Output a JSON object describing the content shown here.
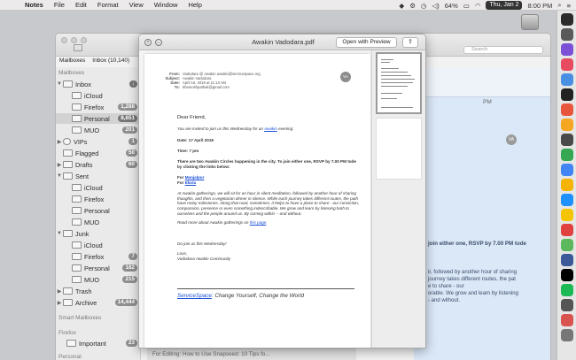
{
  "menubar": {
    "apple": "",
    "app_name": "Notes",
    "items": [
      "File",
      "Edit",
      "Format",
      "View",
      "Window",
      "Help"
    ],
    "battery": "64%",
    "date": "Thu, Jan 2",
    "time": "8:00 PM"
  },
  "mail": {
    "tabs": [
      "Mailboxes",
      "Inbox (10,140)"
    ],
    "search_placeholder": "Search",
    "sidebar": {
      "headers": [
        "Mailboxes",
        "Smart Mailboxes",
        "Firefox",
        "Personal"
      ],
      "rows": [
        {
          "label": "Inbox",
          "count": "",
          "indent": 0
        },
        {
          "label": "iCloud",
          "count": "",
          "indent": 1
        },
        {
          "label": "Firefox",
          "count": "1,288",
          "indent": 1
        },
        {
          "label": "Personal",
          "count": "8,651",
          "indent": 1
        },
        {
          "label": "MUO",
          "count": "201",
          "indent": 1
        },
        {
          "label": "VIPs",
          "count": "1",
          "indent": 0
        },
        {
          "label": "Flagged",
          "count": "50",
          "indent": 0
        },
        {
          "label": "Drafts",
          "count": "60",
          "indent": 0
        },
        {
          "label": "Sent",
          "count": "",
          "indent": 0
        },
        {
          "label": "iCloud",
          "count": "",
          "indent": 1
        },
        {
          "label": "Firefox",
          "count": "",
          "indent": 1
        },
        {
          "label": "Personal",
          "count": "",
          "indent": 1
        },
        {
          "label": "MUO",
          "count": "",
          "indent": 1
        },
        {
          "label": "Junk",
          "count": "",
          "indent": 0
        },
        {
          "label": "iCloud",
          "count": "",
          "indent": 1
        },
        {
          "label": "Firefox",
          "count": "7",
          "indent": 1
        },
        {
          "label": "Personal",
          "count": "182",
          "indent": 1
        },
        {
          "label": "MUO",
          "count": "215",
          "indent": 1
        },
        {
          "label": "Trash",
          "count": "",
          "indent": 0
        },
        {
          "label": "Archive",
          "count": "14,444",
          "indent": 0
        },
        {
          "label": "Important",
          "count": "23",
          "indent": 1
        }
      ]
    },
    "right_pane": {
      "time_fragment": "PM",
      "avatar": "VA",
      "snippets": [
        "join either one, RSVP by 7.00 PM tode",
        "ir, followed by another hour of sharing",
        "journey takes different routes, the pat",
        "e to share - our",
        "orable. We grow and learn by listening",
        "- and without."
      ]
    },
    "bottom_strip": "For Editing: How to Use Snapseed: 10 Tips fo..."
  },
  "preview": {
    "title": "Awakin Vadodara.pdf",
    "open_button": "Open with Preview",
    "share_icon": "share-icon",
    "header": {
      "from_label": "From:",
      "from_value": "Vadodara @ Awakin awakin@servicespace.org",
      "subject_label": "Subject:",
      "subject_value": "Awakin Vadodara",
      "date_label": "Date:",
      "date_value": "April 16, 2019 at 11:13 AM",
      "to_label": "To:",
      "to_value": "khamoshpathak@gmail.com",
      "avatar": "VA"
    },
    "greeting": "Dear Friend,",
    "intro_pre": "You are invited to join us this Wednesday for an ",
    "intro_link": "Awakin",
    "intro_post": " evening:",
    "date_line": "Date: 17 April 2019",
    "time_line": "Time: 7 pm",
    "rsvp": "There are two Awakin Circles happening in the city. To join either one, RSVP by 7.00 PM tode by clicking the links below:",
    "for1_label": "For ",
    "for1_link": "Manjalpur",
    "for2_label": "For ",
    "for2_link": "Ekota",
    "paragraph": "At Awakin gatherings, we will sit for an hour in silent meditation, followed by another hour of sharing thoughts, and then a vegetarian dinner in silence. While each journey takes different routes, the path have many milestones. Along that road, sometimes, it helps to have a place to share - our conviction, compassion, presence or even something indescribable. We grow and learn by listening both to ourselves and the people around us. By coming within -- and without.",
    "read_more_pre": "Read more about Awakin gatherings on ",
    "read_more_link": "this page",
    "read_more_post": ".",
    "join": "Do join us this Wednesday!",
    "love": "Love,",
    "community": "Vadodara Awakin Community",
    "tagline_link": "ServiceSpace",
    "tagline_rest": ": Change Yourself, Change the World"
  },
  "colors": {
    "accent_blue": "#1a4fd6",
    "reading_pane_bg": "#dbe8f8"
  },
  "dock_icon_colors": [
    "#2b2b2b",
    "#5a5a5a",
    "#7b4fd6",
    "#e84a5f",
    "#4a90e2",
    "#222222",
    "#e8553d",
    "#f5a623",
    "#4a4a4a",
    "#36a853",
    "#4285f4",
    "#f4b400",
    "#1e90ff",
    "#f5c400",
    "#e04040",
    "#5cb85c",
    "#3b5998",
    "#000000",
    "#1db954",
    "#555555",
    "#d9534f",
    "#777777"
  ]
}
